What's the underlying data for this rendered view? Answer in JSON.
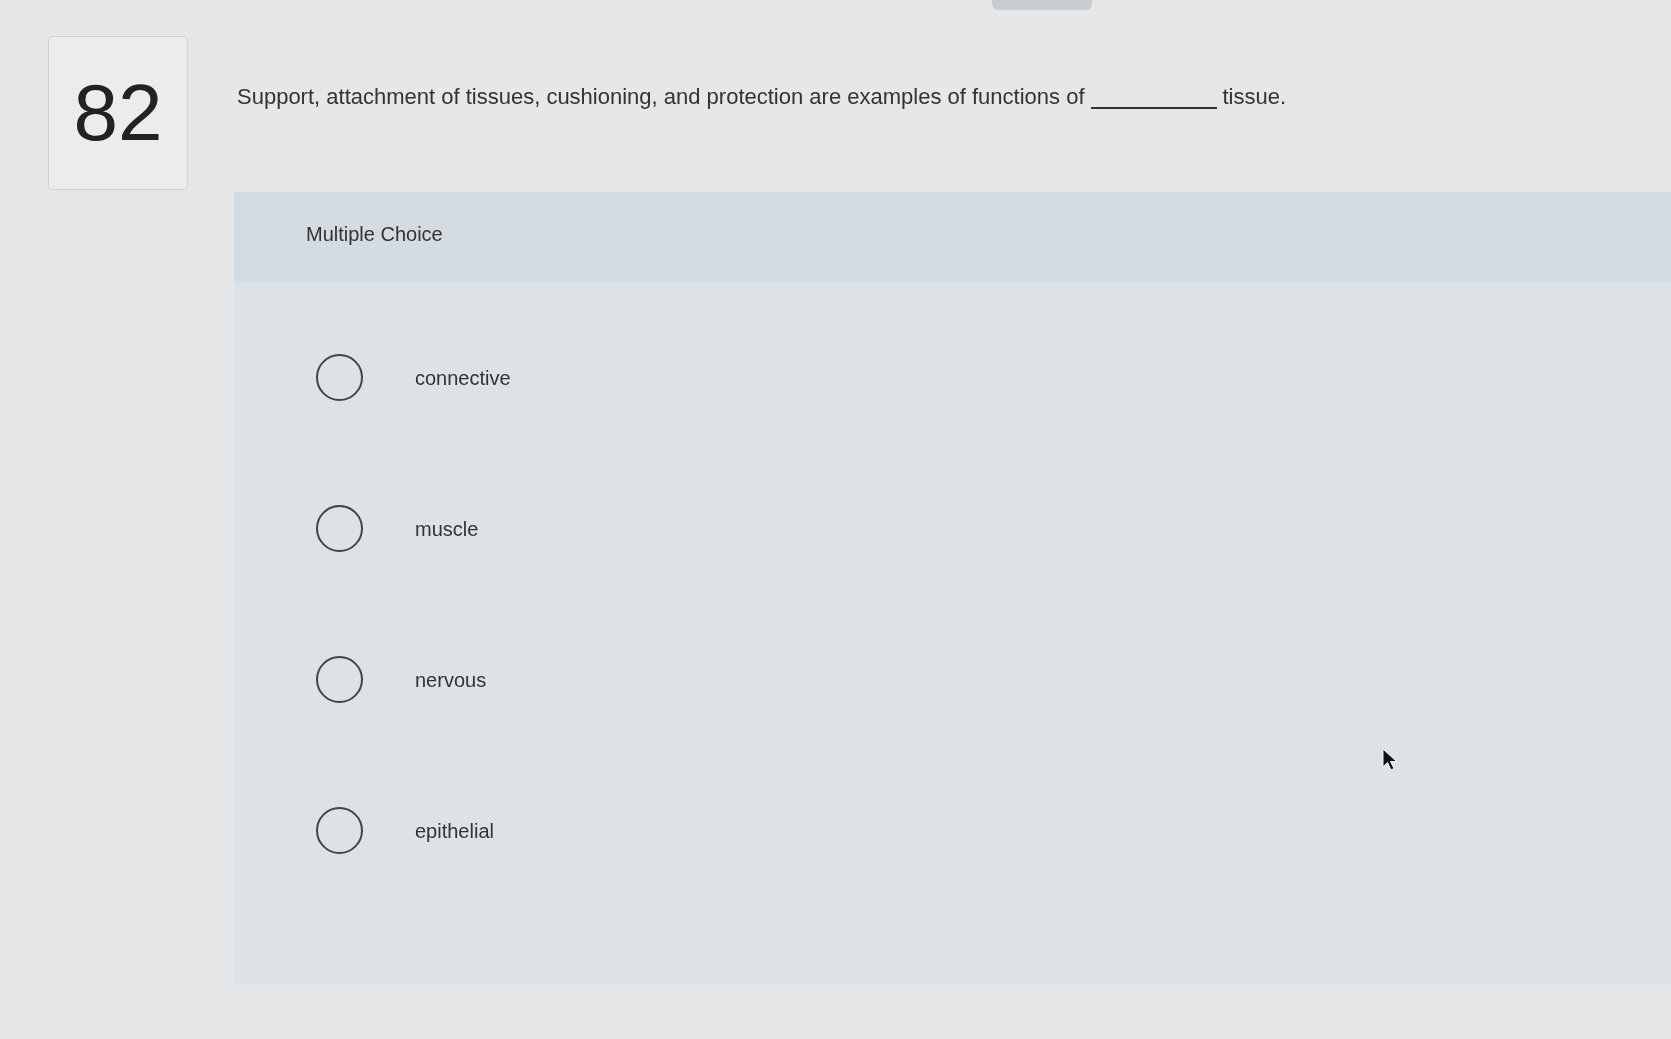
{
  "question": {
    "number": "82",
    "text_before": "Support, attachment of tissues, cushioning, and protection are examples of functions of",
    "text_after": "tissue."
  },
  "answer_panel": {
    "heading": "Multiple Choice",
    "options": [
      {
        "label": "connective",
        "selected": false
      },
      {
        "label": "muscle",
        "selected": false
      },
      {
        "label": "nervous",
        "selected": false
      },
      {
        "label": "epithelial",
        "selected": false
      }
    ]
  }
}
